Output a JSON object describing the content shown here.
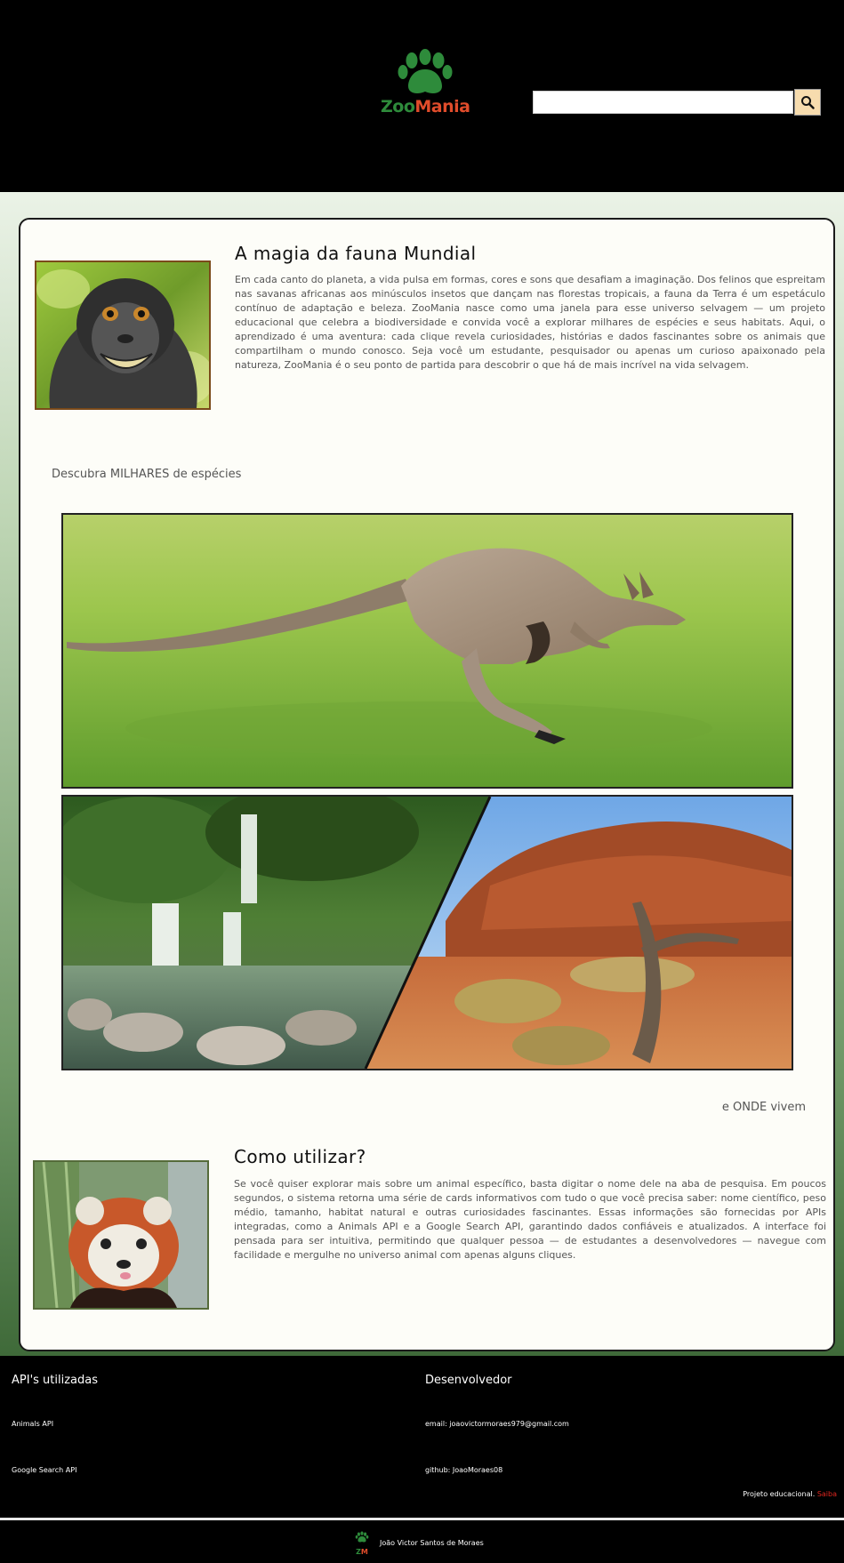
{
  "header": {
    "logo": {
      "part1": "Zoo",
      "part2": "Mania",
      "icon": "paw-icon"
    },
    "search": {
      "placeholder": "",
      "button_icon": "search-icon"
    }
  },
  "section1": {
    "title": "A magia da fauna Mundial",
    "text": "Em cada canto do planeta, a vida pulsa em formas, cores e sons que desafiam a imaginação. Dos felinos que espreitam nas savanas africanas aos minúsculos insetos que dançam nas florestas tropicais, a fauna da Terra é um espetáculo contínuo de adaptação e beleza. ZooMania nasce como uma janela para esse universo selvagem — um projeto educacional que celebra a biodiversidade e convida você a explorar milhares de espécies e seus habitats. Aqui, o aprendizado é uma aventura: cada clique revela curiosidades, histórias e dados fascinantes sobre os animais que compartilham o mundo conosco. Seja você um estudante, pesquisador ou apenas um curioso apaixonado pela natureza, ZooMania é o seu ponto de partida para descobrir o que há de mais incrível na vida selvagem."
  },
  "captions": {
    "species": "Descubra MILHARES de espécies",
    "where": "e ONDE vivem"
  },
  "section2": {
    "title": "Como utilizar?",
    "text": "Se você quiser explorar mais sobre um animal específico, basta digitar o nome dele na aba de pesquisa. Em poucos segundos, o sistema retorna uma série de cards informativos com tudo o que você precisa saber: nome científico, peso médio, tamanho, habitat natural e outras curiosidades fascinantes. Essas informações são fornecidas por APIs integradas, como a Animals API e a Google Search API, garantindo dados confiáveis e atualizados. A interface foi pensada para ser intuitiva, permitindo que qualquer pessoa — de estudantes a desenvolvedores — navegue com facilidade e mergulhe no universo animal com apenas alguns cliques."
  },
  "footer": {
    "apis_title": "API's utilizadas",
    "apis": [
      "Animals API",
      "Google Search API"
    ],
    "dev_title": "Desenvolvedor",
    "dev_email": "email: joaovictormoraes979@gmail.com",
    "dev_github": "github: JoaoMoraes08",
    "note_prefix": "Projeto educacional.",
    "note_accent": "Saiba",
    "credit_name": "João Victor Santos de Moraes",
    "mini_logo": {
      "part1": "Z",
      "part2": "M"
    }
  },
  "colors": {
    "header_bg": "#000000",
    "logo_green": "#2e8b3b",
    "logo_orange": "#e04c2b",
    "search_button_bg": "#f7dcae",
    "accent_red": "#e0261f"
  }
}
